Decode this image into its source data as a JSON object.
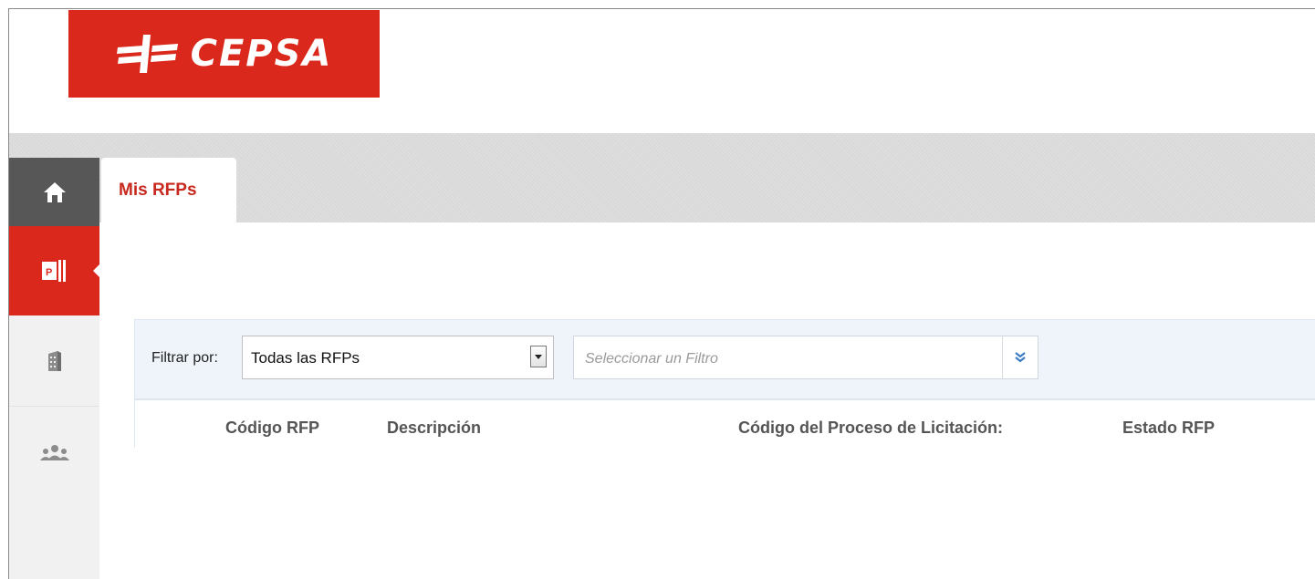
{
  "logo": {
    "text": "CEPSA",
    "color": "#da291c"
  },
  "sidebar": {
    "items": [
      {
        "name": "home",
        "icon": "home-icon",
        "active": false
      },
      {
        "name": "rfps",
        "icon": "rfp-document-icon",
        "active": true
      },
      {
        "name": "company",
        "icon": "building-icon",
        "active": false
      },
      {
        "name": "users",
        "icon": "users-group-icon",
        "active": false
      }
    ]
  },
  "tabs": [
    {
      "label": "Mis RFPs",
      "active": true
    }
  ],
  "filter": {
    "label": "Filtrar por:",
    "selected": "Todas las RFPs",
    "placeholder": "Seleccionar un Filtro"
  },
  "table": {
    "columns": [
      "Código RFP",
      "Descripción",
      "Código del Proceso de Licitación:",
      "Estado RFP"
    ]
  },
  "colors": {
    "accent": "#da291c",
    "tab_text": "#c8281e",
    "sidebar_dark": "#575757"
  }
}
